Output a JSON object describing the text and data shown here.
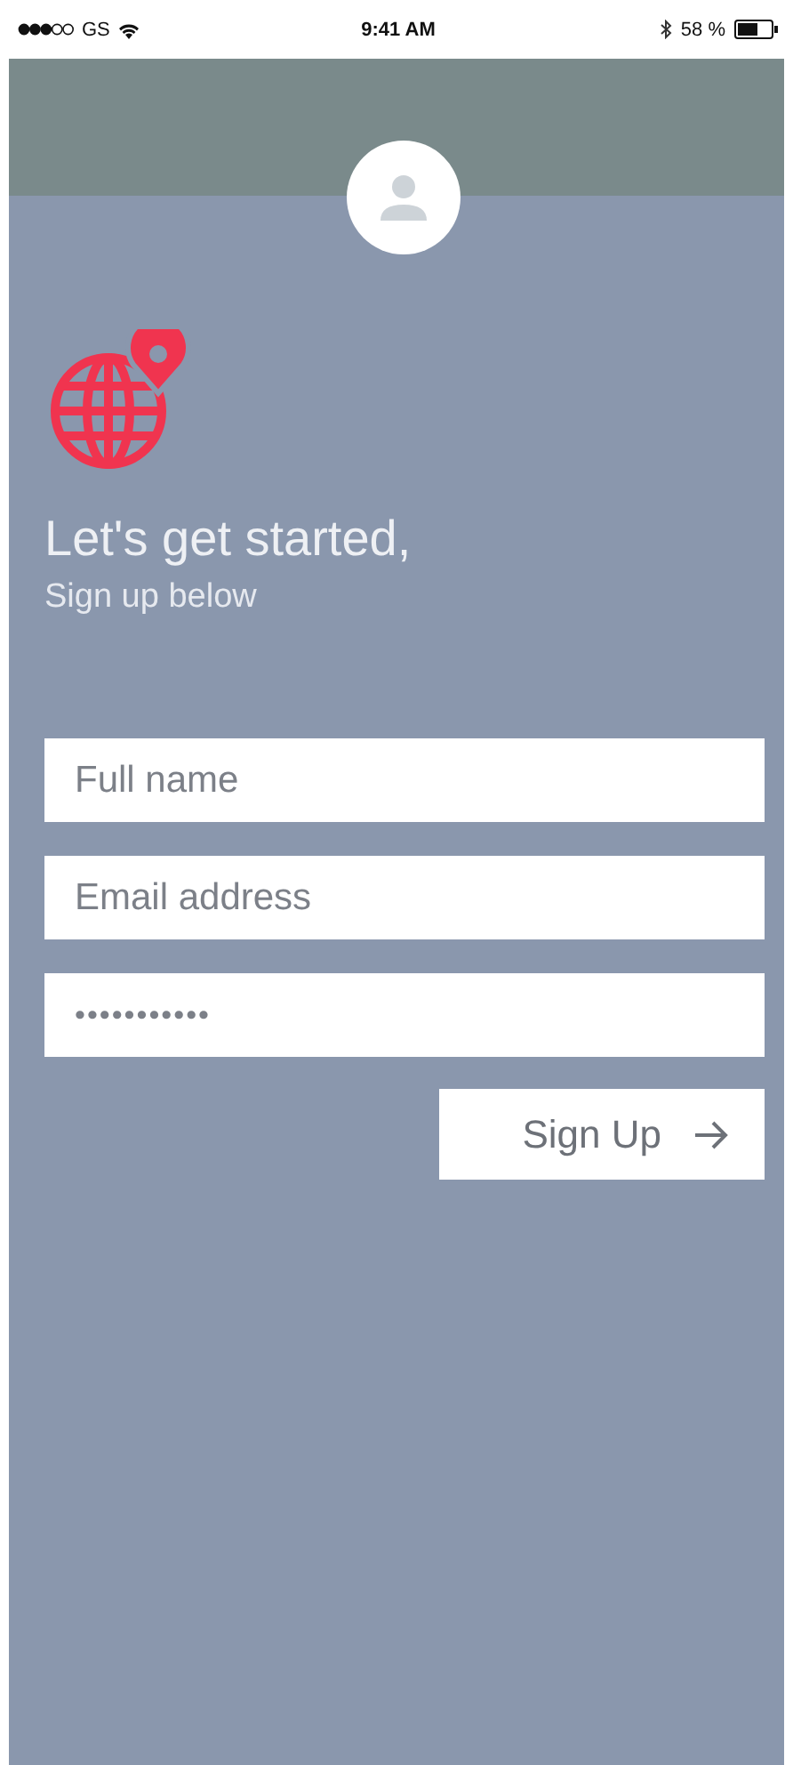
{
  "status_bar": {
    "carrier": "GS",
    "time": "9:41 AM",
    "battery": "58 %"
  },
  "heading": "Let's get started,",
  "subheading": "Sign up below",
  "fields": [
    {
      "placeholder": "Full name"
    },
    {
      "placeholder": "Email address"
    },
    {
      "value": "•••••••••••"
    }
  ],
  "submit": {
    "label": "Sign Up"
  }
}
